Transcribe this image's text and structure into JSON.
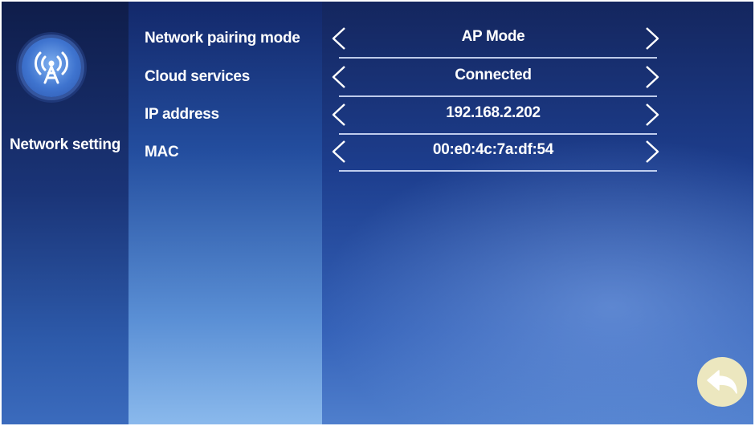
{
  "sidebar": {
    "icon": "wifi-antenna-icon",
    "label": "Network setting"
  },
  "menu": {
    "items": [
      {
        "label": "Network pairing mode"
      },
      {
        "label": "Cloud services"
      },
      {
        "label": "IP address"
      },
      {
        "label": "MAC"
      }
    ]
  },
  "settings": {
    "rows": [
      {
        "value": "AP Mode"
      },
      {
        "value": "Connected"
      },
      {
        "value": "192.168.2.202"
      },
      {
        "value": "00:e0:4c:7a:df:54"
      }
    ]
  },
  "icons": {
    "prev": "chevron-left-icon",
    "next": "chevron-right-icon",
    "back": "back-arrow-icon"
  },
  "colors": {
    "back_button": "#ece7bf",
    "text": "#ffffff"
  }
}
